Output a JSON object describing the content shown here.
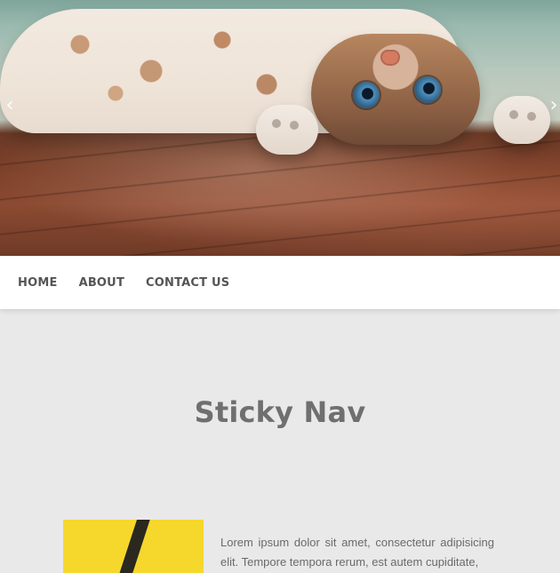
{
  "hero": {
    "left_arrow_icon": "chevron-left-icon",
    "right_arrow_icon": "chevron-right-icon",
    "left_arrow_glyph": "‹",
    "right_arrow_glyph": "›"
  },
  "nav": {
    "items": [
      {
        "label": "HOME"
      },
      {
        "label": "ABOUT"
      },
      {
        "label": "CONTACT US"
      }
    ]
  },
  "main": {
    "title": "Sticky Nav",
    "paragraph": "Lorem ipsum dolor sit amet, consectetur adipisicing elit. Tempore tempora rerum, est autem cupiditate,"
  }
}
